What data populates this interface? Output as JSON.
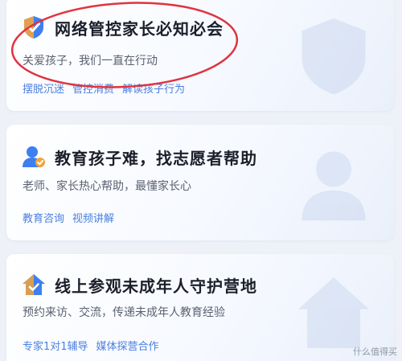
{
  "cards": [
    {
      "title": "网络管控家长必知必会",
      "subtitle": "关爱孩子，我们一直在行动",
      "tags": [
        "摆脱沉迷",
        "管控消费",
        "解读孩子行为"
      ],
      "icon": "shield-check-icon"
    },
    {
      "title": "教育孩子难，找志愿者帮助",
      "subtitle": "老师、家长热心帮助，最懂家长心",
      "tags": [
        "教育咨询",
        "视频讲解"
      ],
      "icon": "person-badge-icon"
    },
    {
      "title": "线上参观未成年人守护营地",
      "subtitle": "预约来访、交流，传递未成年人教育经验",
      "tags": [
        "专家1对1辅导",
        "媒体探营合作"
      ],
      "icon": "home-check-icon"
    }
  ],
  "watermark": "什么值得买",
  "colors": {
    "accent": "#4a7fe0",
    "annotation": "#e0333f",
    "title": "#1b1f2a"
  }
}
